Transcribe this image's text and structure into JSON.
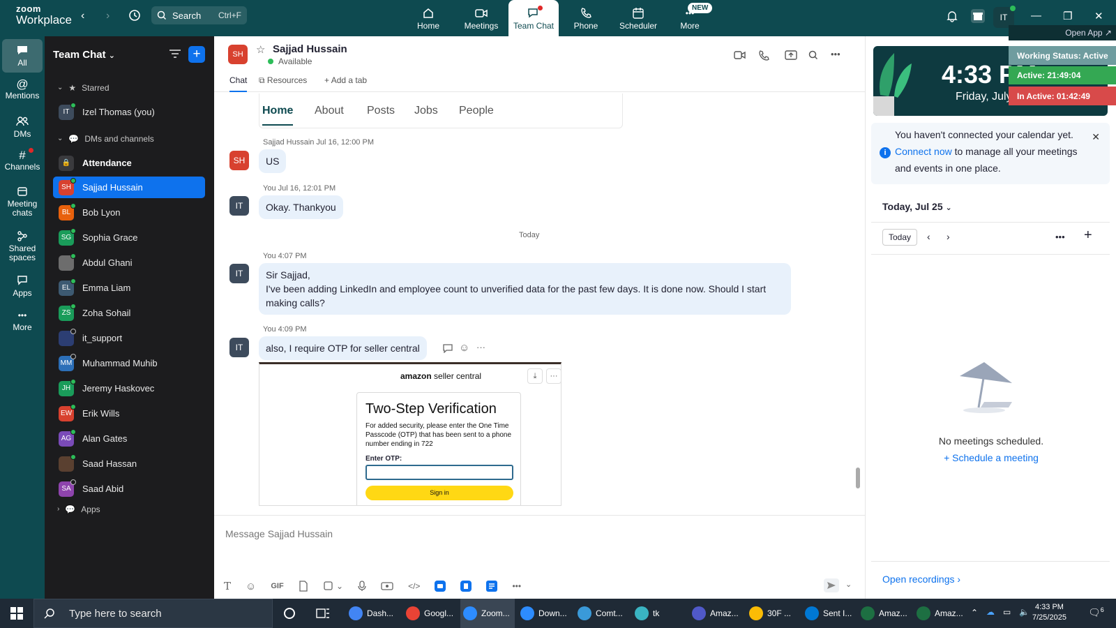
{
  "topbar": {
    "logo_line1": "zoom",
    "logo_line2": "Workplace",
    "search_label": "Search",
    "search_shortcut": "Ctrl+F",
    "tabs": [
      {
        "label": "Home"
      },
      {
        "label": "Meetings"
      },
      {
        "label": "Team Chat"
      },
      {
        "label": "Phone"
      },
      {
        "label": "Scheduler"
      },
      {
        "label": "More"
      }
    ],
    "new_badge": "NEW",
    "avatar_initials": "IT",
    "accent": "#0e4a50"
  },
  "rail": [
    {
      "label": "All"
    },
    {
      "label": "Mentions"
    },
    {
      "label": "DMs"
    },
    {
      "label": "Channels"
    },
    {
      "label": "Meeting chats"
    },
    {
      "label": "Shared spaces"
    },
    {
      "label": "Apps"
    },
    {
      "label": "More"
    }
  ],
  "sidebar": {
    "title": "Team Chat",
    "starred_label": "Starred",
    "dms_label": "DMs and channels",
    "apps_label": "Apps",
    "starred": [
      {
        "initials": "IT",
        "name": "Izel Thomas (you)",
        "color": "#3d4b5c"
      }
    ],
    "channel": "Attendance",
    "contacts": [
      {
        "initials": "SH",
        "name": "Sajjad Hussain",
        "color": "#d8412f"
      },
      {
        "initials": "BL",
        "name": "Bob Lyon",
        "color": "#e8610c"
      },
      {
        "initials": "SG",
        "name": "Sophia Grace",
        "color": "#1a9c5a"
      },
      {
        "initials": "",
        "name": "Abdul Ghani",
        "color": "#6d6d6d"
      },
      {
        "initials": "EL",
        "name": "Emma Liam",
        "color": "#3d5a72"
      },
      {
        "initials": "ZS",
        "name": "Zoha Sohail",
        "color": "#1a9c5a"
      },
      {
        "initials": "",
        "name": "it_support",
        "color": "#2c3e73"
      },
      {
        "initials": "MM",
        "name": "Muhammad Muhib",
        "color": "#2c6fb8"
      },
      {
        "initials": "JH",
        "name": "Jeremy Haskovec",
        "color": "#1a9c5a"
      },
      {
        "initials": "EW",
        "name": "Erik Wills",
        "color": "#d8412f"
      },
      {
        "initials": "AG",
        "name": "Alan Gates",
        "color": "#7a4bb8"
      },
      {
        "initials": "",
        "name": "Saad Hassan",
        "color": "#5a4030"
      },
      {
        "initials": "SA",
        "name": "Saad Abid",
        "color": "#8e44ad"
      }
    ]
  },
  "chat": {
    "contact_initials": "SH",
    "contact_name": "Sajjad Hussain",
    "status": "Available",
    "tabs": {
      "chat": "Chat",
      "resources": "Resources",
      "add": "Add a tab"
    },
    "card_tabs": [
      "Home",
      "About",
      "Posts",
      "Jobs",
      "People"
    ],
    "messages": [
      {
        "initials": "SH",
        "meta": "Sajjad Hussain Jul 16, 12:00 PM",
        "text": "US"
      },
      {
        "initials": "IT",
        "meta": "You Jul 16, 12:01 PM",
        "text": "Okay. Thankyou"
      },
      {
        "initials": "IT",
        "meta": "You 4:07 PM",
        "line1": "Sir Sajjad,",
        "line2": "I've been adding LinkedIn and employee count to unverified data for the past few days. It is done now. Should I start making calls?"
      },
      {
        "initials": "IT",
        "meta": "You 4:09 PM",
        "text": "also, I require OTP for seller central"
      }
    ],
    "today_label": "Today",
    "attachment": {
      "brand_bold": "amazon",
      "brand_rest": " seller central",
      "heading": "Two-Step Verification",
      "body": "For added security, please enter the One Time Passcode (OTP) that has been sent to a phone number ending in 722",
      "otp_label": "Enter OTP:",
      "button": "Sign in"
    },
    "composer_placeholder": "Message Sajjad Hussain",
    "composer_gif": "GIF"
  },
  "right": {
    "open_app": "Open App ↗",
    "clock_time": "4:33 PM",
    "clock_date": "Friday, July 25",
    "working_status": "Working Status: Active",
    "active": "Active: 21:49:04",
    "in_active": "In Active: 01:42:49",
    "cal_note_pre": "You haven't connected your calendar yet. ",
    "cal_note_link": "Connect now",
    "cal_note_post": " to manage all your meetings and events in one place.",
    "day_label": "Today, Jul 25",
    "today_btn": "Today",
    "no_meetings": "No meetings scheduled.",
    "schedule": "Schedule a meeting",
    "open_recordings": "Open recordings"
  },
  "taskbar": {
    "search": "Type here to search",
    "apps": [
      {
        "label": "Dash...",
        "color": "#4285f4"
      },
      {
        "label": "Googl...",
        "color": "#ea4335"
      },
      {
        "label": "Zoom...",
        "color": "#2d8cff"
      },
      {
        "label": "Down...",
        "color": "#2d8cff"
      },
      {
        "label": "Comt...",
        "color": "#3a9ad9"
      },
      {
        "label": "tk",
        "color": "#3ab4c2"
      },
      {
        "label": "Amaz...",
        "color": "#5059c9"
      },
      {
        "label": "30F ...",
        "color": "#fbbc05"
      },
      {
        "label": "Sent I...",
        "color": "#0078d4"
      },
      {
        "label": "Amaz...",
        "color": "#1d6f42"
      },
      {
        "label": "Amaz...",
        "color": "#1d6f42"
      }
    ],
    "time": "4:33 PM",
    "date": "7/25/2025",
    "notif_count": "6"
  }
}
